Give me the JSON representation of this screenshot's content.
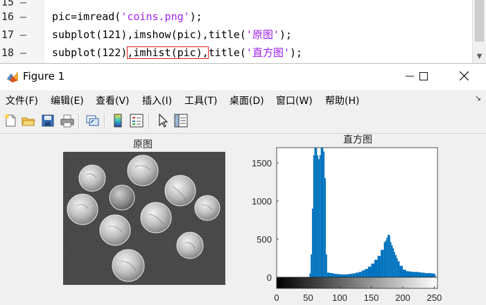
{
  "editor": {
    "lines": [
      {
        "num": "15",
        "parts": []
      },
      {
        "num": "16",
        "parts": [
          [
            "pic=imread(",
            "n"
          ],
          [
            "'coins.png'",
            "s"
          ],
          [
            ");",
            "n"
          ]
        ]
      },
      {
        "num": "17",
        "parts": [
          [
            "subplot(121),imshow(pic),title(",
            "n"
          ],
          [
            "'原图'",
            "s"
          ],
          [
            ");",
            "n"
          ]
        ]
      },
      {
        "num": "18",
        "parts": [
          [
            "subplot(122)",
            "n"
          ],
          [
            ",imhist(pic),",
            "h"
          ],
          [
            "title(",
            "n"
          ],
          [
            "'直方图'",
            "s"
          ],
          [
            ");",
            "n"
          ]
        ]
      }
    ],
    "dash": "—",
    "highlight_color": "#e02020",
    "string_color": "#a020f0"
  },
  "window": {
    "title": "Figure 1",
    "icon": "matlab-icon",
    "minimize_glyph": "—",
    "maximize_glyph": "☐",
    "close_glyph": "✕"
  },
  "menubar": {
    "items": [
      "文件(F)",
      "编辑(E)",
      "查看(V)",
      "插入(I)",
      "工具(T)",
      "桌面(D)",
      "窗口(W)",
      "帮助(H)"
    ],
    "end_glyph": "↘"
  },
  "toolbar": {
    "icons": [
      "new-figure-icon",
      "open-file-icon",
      "save-icon",
      "print-icon",
      "link-plot-icon",
      "colorbar-icon",
      "legend-icon",
      "edit-plot-arrow-icon",
      "property-inspector-icon"
    ]
  },
  "subplot_left": {
    "title": "原图"
  },
  "chart_data": {
    "type": "bar",
    "title": "直方图",
    "xlabel": "",
    "ylabel": "",
    "xlim": [
      0,
      255
    ],
    "ylim": [
      0,
      1700
    ],
    "xticks": [
      0,
      50,
      100,
      150,
      200,
      250
    ],
    "yticks": [
      0,
      500,
      1000,
      1500
    ],
    "bar_color": "#0072bd",
    "colorbar": "grayscale",
    "series": [
      {
        "x": [
          52,
          54,
          56,
          58,
          60,
          62,
          64,
          66,
          68,
          70,
          72,
          74,
          76,
          78,
          80,
          85,
          90,
          95,
          100,
          105,
          110,
          115,
          120,
          125,
          130,
          135,
          140,
          145,
          150,
          155,
          160,
          165,
          170,
          172,
          174,
          176,
          178,
          180,
          182,
          184,
          186,
          188,
          190,
          192,
          195,
          200,
          205,
          210,
          215,
          220,
          225,
          230,
          235,
          240,
          245,
          250
        ],
        "values": [
          50,
          300,
          900,
          1600,
          1700,
          1700,
          1600,
          1550,
          1600,
          1700,
          1700,
          1650,
          1300,
          300,
          60,
          55,
          45,
          42,
          38,
          36,
          40,
          45,
          50,
          60,
          70,
          90,
          110,
          140,
          180,
          230,
          280,
          360,
          460,
          480,
          520,
          560,
          550,
          460,
          420,
          380,
          330,
          290,
          250,
          210,
          150,
          100,
          80,
          75,
          70,
          70,
          65,
          60,
          55,
          55,
          50,
          40
        ]
      }
    ]
  }
}
